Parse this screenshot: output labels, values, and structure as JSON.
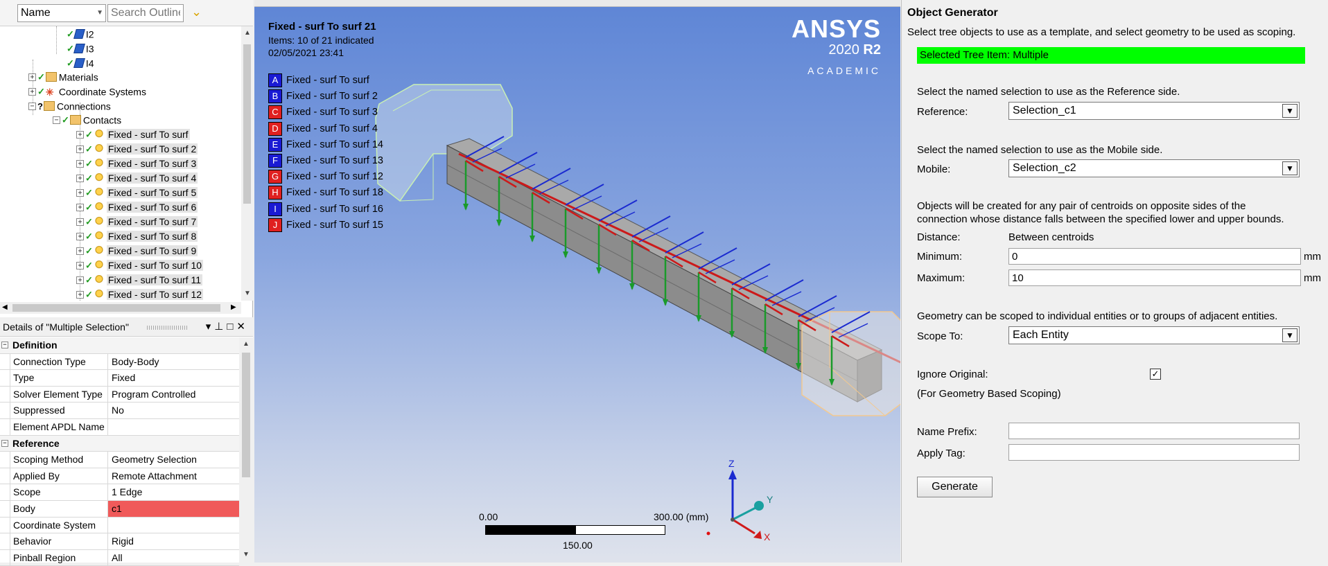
{
  "outline": {
    "name_combo": "Name",
    "search_placeholder": "Search Outline",
    "items": {
      "i2": "I2",
      "i3": "I3",
      "i4": "I4",
      "materials": "Materials",
      "coordinate_systems": "Coordinate Systems",
      "connections": "Connections",
      "contacts": "Contacts"
    },
    "contacts": [
      "Fixed - surf To surf",
      "Fixed - surf To surf 2",
      "Fixed - surf To surf 3",
      "Fixed - surf To surf 4",
      "Fixed - surf To surf 5",
      "Fixed - surf To surf 6",
      "Fixed - surf To surf 7",
      "Fixed - surf To surf 8",
      "Fixed - surf To surf 9",
      "Fixed - surf To surf 10",
      "Fixed - surf To surf 11",
      "Fixed - surf To surf 12"
    ]
  },
  "details": {
    "title": "Details of \"Multiple Selection\"",
    "groups": {
      "definition": "Definition",
      "reference": "Reference"
    },
    "rows": {
      "connection_type": {
        "label": "Connection Type",
        "value": "Body-Body"
      },
      "type": {
        "label": "Type",
        "value": "Fixed"
      },
      "solver_element_type": {
        "label": "Solver Element Type",
        "value": "Program Controlled"
      },
      "suppressed": {
        "label": "Suppressed",
        "value": "No"
      },
      "element_apdl_name": {
        "label": "Element APDL Name",
        "value": ""
      },
      "scoping_method": {
        "label": "Scoping Method",
        "value": "Geometry Selection"
      },
      "applied_by": {
        "label": "Applied By",
        "value": "Remote Attachment"
      },
      "scope": {
        "label": "Scope",
        "value": "1 Edge"
      },
      "body": {
        "label": "Body",
        "value": "c1"
      },
      "coordinate_system": {
        "label": "Coordinate System",
        "value": ""
      },
      "behavior": {
        "label": "Behavior",
        "value": "Rigid"
      },
      "pinball_region": {
        "label": "Pinball Region",
        "value": "All"
      }
    }
  },
  "viewport": {
    "title": "Fixed - surf To surf 21",
    "items_indicated": "Items: 10 of 21 indicated",
    "timestamp": "02/05/2021 23:41",
    "legend": [
      {
        "key": "A",
        "label": "Fixed - surf To surf",
        "color": "#1a1ad4"
      },
      {
        "key": "B",
        "label": "Fixed - surf To surf 2",
        "color": "#1a1ad4"
      },
      {
        "key": "C",
        "label": "Fixed - surf To surf 3",
        "color": "#e02020"
      },
      {
        "key": "D",
        "label": "Fixed - surf To surf 4",
        "color": "#e02020"
      },
      {
        "key": "E",
        "label": "Fixed - surf To surf 14",
        "color": "#1a1ad4"
      },
      {
        "key": "F",
        "label": "Fixed - surf To surf 13",
        "color": "#1a1ad4"
      },
      {
        "key": "G",
        "label": "Fixed - surf To surf 12",
        "color": "#e02020"
      },
      {
        "key": "H",
        "label": "Fixed - surf To surf 18",
        "color": "#e02020"
      },
      {
        "key": "I",
        "label": "Fixed - surf To surf 16",
        "color": "#1a1ad4"
      },
      {
        "key": "J",
        "label": "Fixed - surf To surf 15",
        "color": "#e02020"
      }
    ],
    "logo": {
      "brand": "ANSYS",
      "version": "2020",
      "release": "R2",
      "edition": "ACADEMIC"
    },
    "scale": {
      "min": "0.00",
      "max": "300.00 (mm)",
      "mid": "150.00"
    },
    "axes": {
      "x": "X",
      "y": "Y",
      "z": "Z"
    }
  },
  "generator": {
    "title": "Object Generator",
    "intro": "Select tree objects to use as a template, and select geometry to be used as scoping.",
    "selected_item": "Selected Tree Item: Multiple",
    "reference_prompt": "Select the named selection to use as the Reference side.",
    "reference_label": "Reference:",
    "reference_value": "Selection_c1",
    "mobile_prompt": "Select the named selection to use as the Mobile side.",
    "mobile_label": "Mobile:",
    "mobile_value": "Selection_c2",
    "pair_text_1": "Objects will be created for any pair of centroids on opposite sides of the",
    "pair_text_2": "connection whose distance falls between the specified lower and upper bounds.",
    "distance_label": "Distance:",
    "distance_value": "Between centroids",
    "minimum_label": "Minimum:",
    "minimum_value": "0",
    "maximum_label": "Maximum:",
    "maximum_value": "10",
    "unit": "mm",
    "scope_text": "Geometry can be scoped to individual entities or to groups of adjacent entities.",
    "scope_label": "Scope To:",
    "scope_value": "Each Entity",
    "ignore_label": "Ignore Original:",
    "ignore_checked": "✓",
    "ignore_note": "(For Geometry Based Scoping)",
    "name_prefix_label": "Name Prefix:",
    "apply_tag_label": "Apply Tag:",
    "generate_label": "Generate"
  }
}
